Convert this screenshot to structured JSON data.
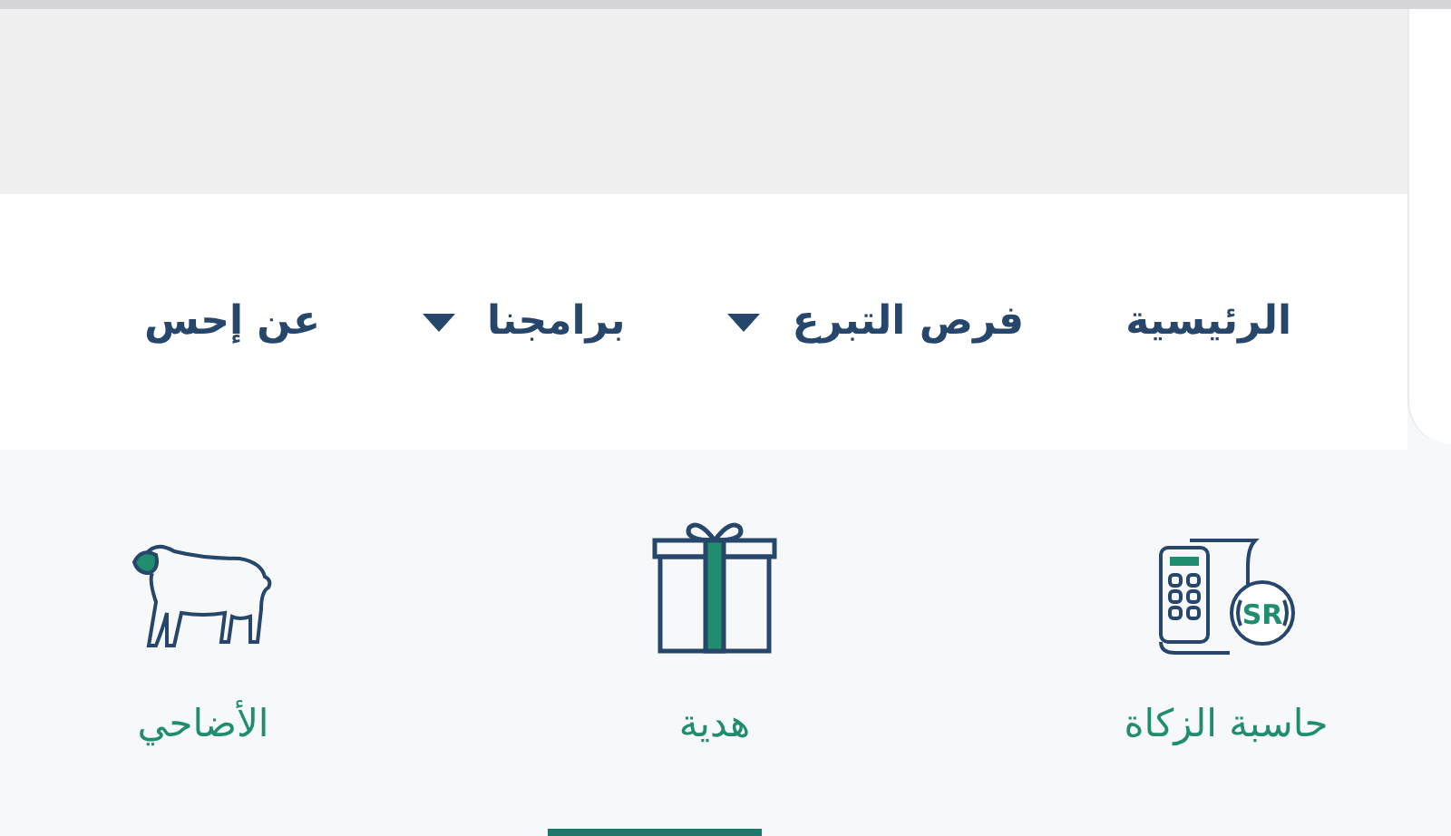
{
  "nav": {
    "items": [
      {
        "label": "الرئيسية",
        "has_dropdown": false
      },
      {
        "label": "فرص التبرع",
        "has_dropdown": true
      },
      {
        "label": "برامجنا",
        "has_dropdown": true
      },
      {
        "label": "عن إحس",
        "has_dropdown": false
      }
    ]
  },
  "services": [
    {
      "kind": "zakat-calculator",
      "label": "حاسبة الزكاة",
      "badge": "SR"
    },
    {
      "kind": "gift",
      "label": "هدية"
    },
    {
      "kind": "sheep",
      "label": "الأضاحي"
    }
  ]
}
